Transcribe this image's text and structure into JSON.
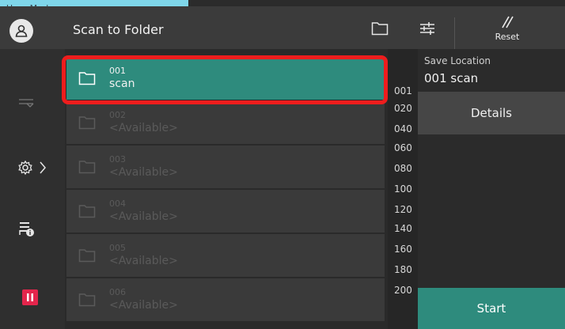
{
  "mode_tab": "User Mode",
  "header": {
    "title": "Scan to Folder",
    "reset_label": "Reset"
  },
  "list": {
    "rows": [
      {
        "number": "001",
        "name": "scan",
        "selected": true
      },
      {
        "number": "002",
        "name": "<Available>",
        "selected": false
      },
      {
        "number": "003",
        "name": "<Available>",
        "selected": false
      },
      {
        "number": "004",
        "name": "<Available>",
        "selected": false
      },
      {
        "number": "005",
        "name": "<Available>",
        "selected": false
      },
      {
        "number": "006",
        "name": "<Available>",
        "selected": false
      }
    ]
  },
  "index": [
    "001",
    "020",
    "040",
    "060",
    "080",
    "100",
    "120",
    "140",
    "160",
    "180",
    "200"
  ],
  "right": {
    "save_location_label": "Save Location",
    "save_location_value": "001 scan",
    "details_label": "Details",
    "start_label": "Start"
  },
  "colors": {
    "accent": "#2e8b7d",
    "highlight": "#ee1d1d",
    "mode_tab": "#7fd6ea",
    "pause": "#e4254c"
  },
  "icons": {
    "user": "user-icon",
    "folder": "folder-icon",
    "adjust": "adjust-icon",
    "reset": "reset-icon",
    "settings": "gear-icon",
    "printer_info": "printer-info-icon",
    "pause": "pause-icon"
  }
}
